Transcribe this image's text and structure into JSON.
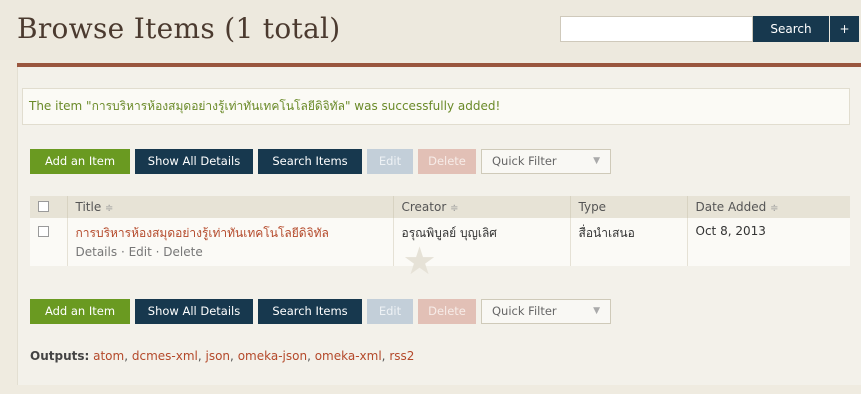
{
  "header": {
    "title": "Browse Items (1 total)",
    "search": {
      "value": "",
      "placeholder": "",
      "button_label": "Search",
      "advanced_label": "+"
    }
  },
  "flash": "The item \"การบริหารห้องสมุดอย่างรู้เท่าทันเทคโนโลยีดิจิทัล\" was successfully added!",
  "actions": {
    "add": "Add an Item",
    "show_details": "Show All Details",
    "search_items": "Search Items",
    "edit": "Edit",
    "delete": "Delete",
    "quick_filter": "Quick Filter"
  },
  "table": {
    "headers": {
      "title": "Title",
      "creator": "Creator",
      "type": "Type",
      "date_added": "Date Added"
    },
    "sort_glyph": "≑",
    "rows": [
      {
        "title": "การบริหารห้องสมุดอย่างรู้เท่าทันเทคโนโลยีดิจิทัล",
        "details": "Details",
        "edit": "Edit",
        "delete": "Delete",
        "creator": "อรุณพิบูลย์ บุญเลิศ",
        "type": "สื่อนำเสนอ",
        "date_added": "Oct 8, 2013"
      }
    ]
  },
  "outputs": {
    "label": "Outputs:",
    "formats": [
      "atom",
      "dcmes-xml",
      "json",
      "omeka-json",
      "omeka-xml",
      "rss2"
    ]
  },
  "colors": {
    "brand_rule": "#9a573f",
    "primary_button": "#17384e",
    "add_button": "#6a9a21",
    "link": "#b4492a",
    "flash_text": "#6a8a28"
  },
  "icons": {
    "caret": "chevron-down-icon",
    "featured": "star-icon"
  }
}
